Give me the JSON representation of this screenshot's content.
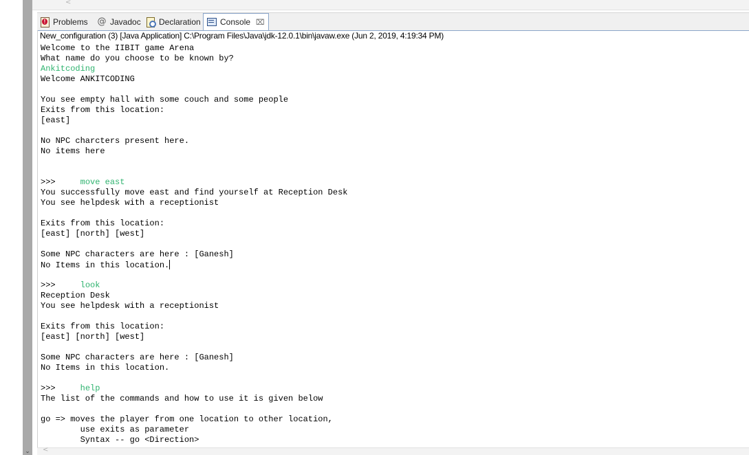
{
  "tabs": [
    {
      "label": "Problems",
      "icon": "problems-icon",
      "active": false
    },
    {
      "label": "Javadoc",
      "icon": "javadoc-icon",
      "active": false
    },
    {
      "label": "Declaration",
      "icon": "declaration-icon",
      "active": false
    },
    {
      "label": "Console",
      "icon": "console-icon",
      "active": true
    }
  ],
  "console": {
    "header": "New_configuration (3) [Java Application] C:\\Program Files\\Java\\jdk-12.0.1\\bin\\javaw.exe (Jun 2, 2019, 4:19:34 PM)",
    "input_color": "#2fb36f",
    "lines": [
      {
        "type": "out",
        "text": "Welcome to the IIBIT game Arena"
      },
      {
        "type": "out",
        "text": "What name do you choose to be known by?"
      },
      {
        "type": "in",
        "text": "Ankitcoding"
      },
      {
        "type": "out",
        "text": "Welcome ANKITCODING"
      },
      {
        "type": "out",
        "text": ""
      },
      {
        "type": "out",
        "text": "You see empty hall with some couch and some people"
      },
      {
        "type": "out",
        "text": "Exits from this location:"
      },
      {
        "type": "out",
        "text": "[east]"
      },
      {
        "type": "out",
        "text": ""
      },
      {
        "type": "out",
        "text": "No NPC charcters present here."
      },
      {
        "type": "out",
        "text": "No items here"
      },
      {
        "type": "out",
        "text": ""
      },
      {
        "type": "out",
        "text": ""
      },
      {
        "type": "prompt",
        "prompt": ">>>",
        "text": "move east"
      },
      {
        "type": "out",
        "text": "You successfully move east and find yourself at Reception Desk"
      },
      {
        "type": "out",
        "text": "You see helpdesk with a receptionist"
      },
      {
        "type": "out",
        "text": ""
      },
      {
        "type": "out",
        "text": "Exits from this location:"
      },
      {
        "type": "out",
        "text": "[east] [north] [west]"
      },
      {
        "type": "out",
        "text": ""
      },
      {
        "type": "out",
        "text": "Some NPC characters are here : [Ganesh]"
      },
      {
        "type": "out",
        "text": "No Items in this location.",
        "caret": true
      },
      {
        "type": "out",
        "text": ""
      },
      {
        "type": "prompt",
        "prompt": ">>>",
        "text": "look"
      },
      {
        "type": "out",
        "text": "Reception Desk"
      },
      {
        "type": "out",
        "text": "You see helpdesk with a receptionist"
      },
      {
        "type": "out",
        "text": ""
      },
      {
        "type": "out",
        "text": "Exits from this location:"
      },
      {
        "type": "out",
        "text": "[east] [north] [west]"
      },
      {
        "type": "out",
        "text": ""
      },
      {
        "type": "out",
        "text": "Some NPC characters are here : [Ganesh]"
      },
      {
        "type": "out",
        "text": "No Items in this location."
      },
      {
        "type": "out",
        "text": ""
      },
      {
        "type": "prompt",
        "prompt": ">>>",
        "text": "help"
      },
      {
        "type": "out",
        "text": "The list of the commands and how to use it is given below"
      },
      {
        "type": "out",
        "text": ""
      },
      {
        "type": "out",
        "text": "go => moves the player from one location to other location,"
      },
      {
        "type": "out",
        "text": "        use exits as parameter"
      },
      {
        "type": "out",
        "text": "        Syntax -- go <Direction>"
      }
    ]
  }
}
